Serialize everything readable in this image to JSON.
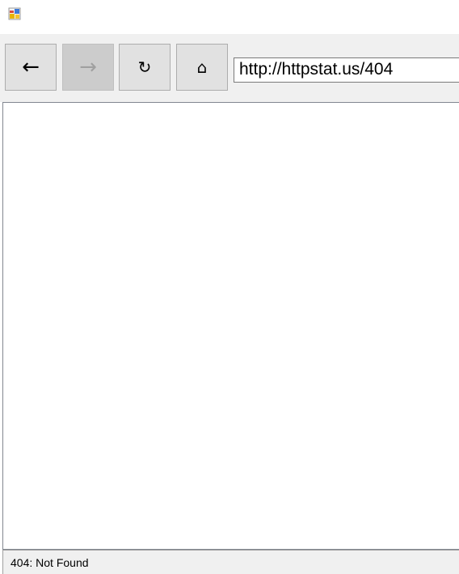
{
  "window": {
    "icon": "app-window-icon"
  },
  "toolbar": {
    "back_label": "←",
    "forward_label": "→",
    "refresh_label": "↻",
    "home_label": "⌂",
    "back_icon": "arrow-left-icon",
    "forward_icon": "arrow-right-icon",
    "refresh_icon": "refresh-icon",
    "home_icon": "home-icon",
    "forward_enabled": false
  },
  "address_bar": {
    "value": "http://httpstat.us/404"
  },
  "status_bar": {
    "text": "404: Not Found"
  },
  "colors": {
    "toolbar_bg": "#f0f0f0",
    "button_bg": "#e1e1e1",
    "button_disabled_bg": "#cccccc",
    "content_bg": "#ffffff"
  }
}
